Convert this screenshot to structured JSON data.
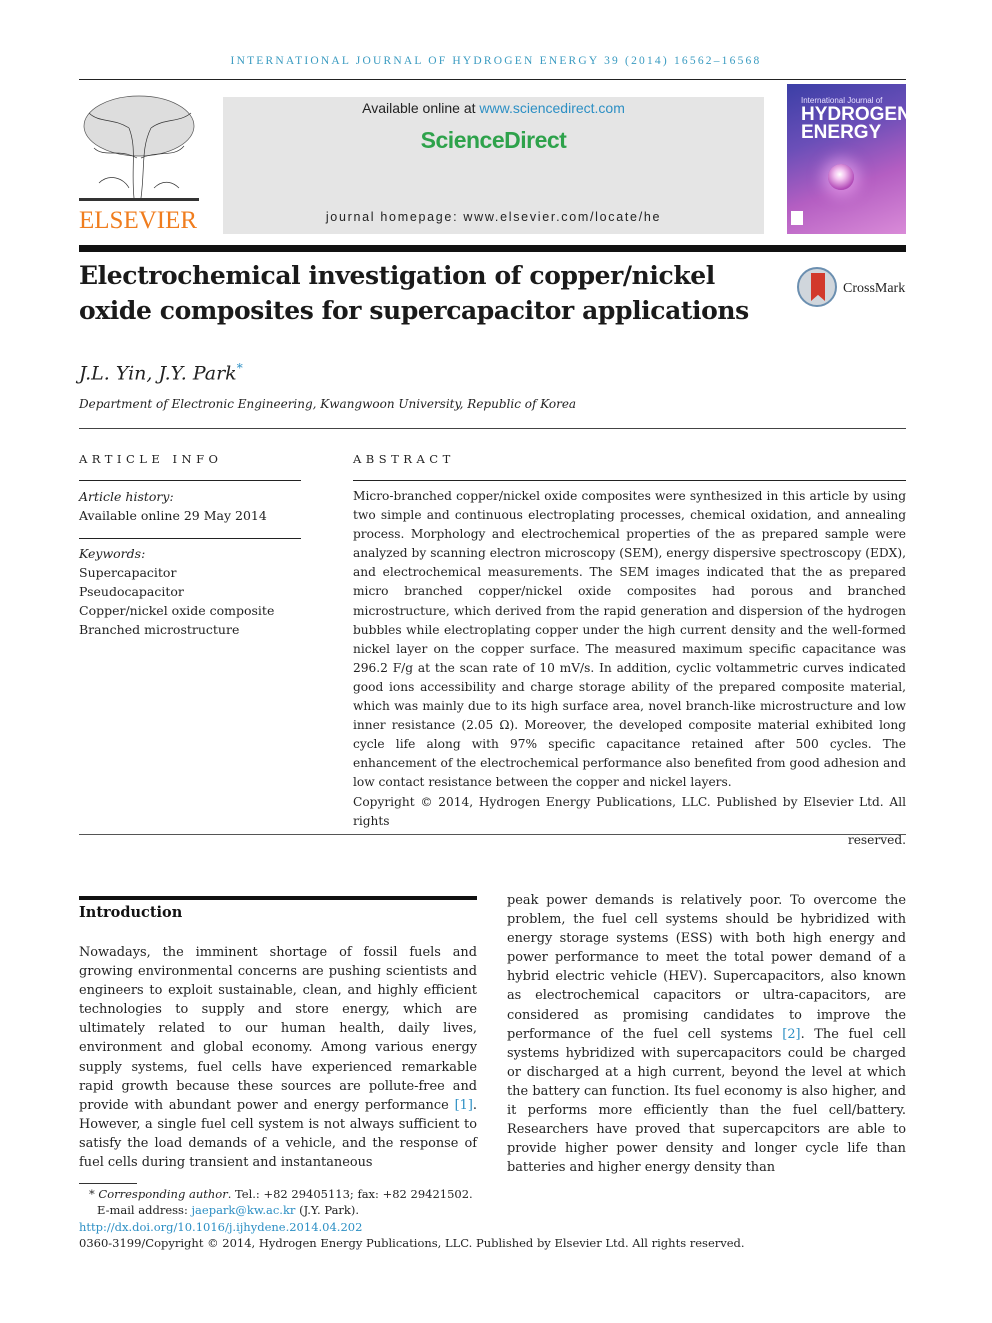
{
  "header": {
    "running_head": "INTERNATIONAL JOURNAL OF HYDROGEN ENERGY 39 (2014) 16562–16568",
    "publisher_logo_text": "ELSEVIER",
    "available_prefix": "Available online at ",
    "available_link": "www.sciencedirect.com",
    "brand": "ScienceDirect",
    "homepage": "journal homepage: www.elsevier.com/locate/he",
    "cover": {
      "line1": "International Journal of",
      "line2": "HYDROGEN",
      "line3": "ENERGY"
    },
    "crossmark_label": "CrossMark"
  },
  "article": {
    "title_line1": "Electrochemical investigation of copper/nickel",
    "title_line2": "oxide composites for supercapacitor applications",
    "authors": "J.L. Yin, J.Y. Park",
    "author_mark": "*",
    "affiliation": "Department of Electronic Engineering, Kwangwoon University, Republic of Korea"
  },
  "article_info": {
    "heading": "ARTICLE INFO",
    "history_label": "Article history:",
    "history_value": "Available online 29 May 2014",
    "keywords_label": "Keywords:",
    "keywords": [
      "Supercapacitor",
      "Pseudocapacitor",
      "Copper/nickel oxide composite",
      "Branched microstructure"
    ]
  },
  "abstract": {
    "heading": "ABSTRACT",
    "text": "Micro-branched copper/nickel oxide composites were synthesized in this article by using two simple and continuous electroplating processes, chemical oxidation, and annealing process. Morphology and electrochemical properties of the as prepared sample were analyzed by scanning electron microscopy (SEM), energy dispersive spectroscopy (EDX), and electrochemical measurements. The SEM images indicated that the as prepared micro branched copper/nickel oxide composites had porous and branched microstructure, which derived from the rapid generation and dispersion of the hydrogen bubbles while electroplating copper under the high current density and the well-formed nickel layer on the copper surface. The measured maximum specific capacitance was 296.2 F/g at the scan rate of 10 mV/s. In addition, cyclic voltammetric curves indicated good ions accessibility and charge storage ability of the prepared composite material, which was mainly due to its high surface area, novel branch-like microstructure and low inner resistance (2.05 Ω). Moreover, the developed composite material exhibited long cycle life along with 97% specific capacitance retained after 500 cycles. The enhancement of the electrochemical performance also benefited from good adhesion and low contact resistance between the copper and nickel layers.",
    "copyright": "Copyright © 2014, Hydrogen Energy Publications, LLC. Published by Elsevier Ltd. All rights",
    "copyright_end": "reserved."
  },
  "introduction": {
    "heading": "Introduction",
    "left_a": "Nowadays, the imminent shortage of fossil fuels and growing environmental concerns are pushing scientists and engineers to exploit sustainable, clean, and highly efficient technologies to supply and store energy, which are ultimately related to our human health, daily lives, environment and global economy. Among various energy supply systems, fuel cells have experienced remarkable rapid growth because these sources are pollute-free and provide with abundant power and energy performance ",
    "cite1": "[1]",
    "left_b": ". However, a single fuel cell system is not always sufficient to satisfy the load demands of a vehicle, and the response of fuel cells during transient and instantaneous",
    "right_a": "peak power demands is relatively poor. To overcome the problem, the fuel cell systems should be hybridized with energy storage systems (ESS) with both high energy and power performance to meet the total power demand of a hybrid electric vehicle (HEV). Supercapacitors, also known as electrochemical capacitors or ultra-capacitors, are considered as promising candidates to improve the performance of the fuel cell systems ",
    "cite2": "[2]",
    "right_b": ". The fuel cell systems hybridized with supercapacitors could be charged or discharged at a high current, beyond the level at which the battery can function. Its fuel economy is also higher, and it performs more efficiently than the fuel cell/battery. Researchers have proved that supercapcitors are able to provide higher power density and longer cycle life than batteries and higher energy density than"
  },
  "footnotes": {
    "corr_mark": "*",
    "corr_label": "Corresponding author",
    "corr_contact": ". Tel.: +82 29405113; fax: +82 29421502.",
    "email_label": "E-mail address: ",
    "email": "jaepark@kw.ac.kr",
    "email_suffix": " (J.Y. Park).",
    "doi": "http://dx.doi.org/10.1016/j.ijhydene.2014.04.202",
    "issn_copyright": "0360-3199/Copyright © 2014, Hydrogen Energy Publications, LLC. Published by Elsevier Ltd. All rights reserved."
  }
}
